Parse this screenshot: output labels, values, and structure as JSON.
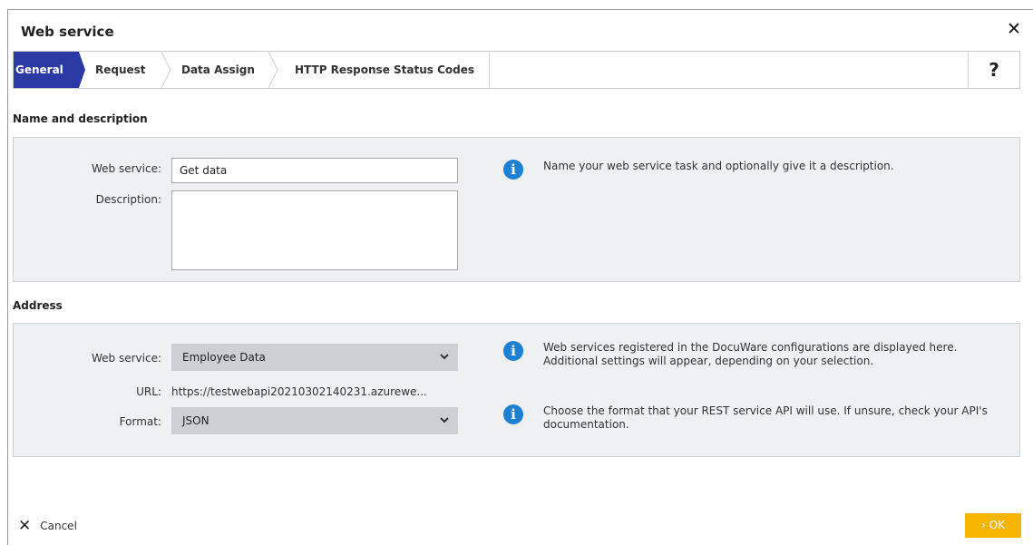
{
  "dialog": {
    "title": "Web service",
    "close_glyph": "✕"
  },
  "tabs": [
    {
      "label": "General",
      "active": true
    },
    {
      "label": "Request",
      "active": false
    },
    {
      "label": "Data Assign",
      "active": false
    },
    {
      "label": "HTTP Response Status Codes",
      "active": false
    }
  ],
  "help_glyph": "?",
  "name_section": {
    "heading": "Name and description",
    "web_service_label": "Web service:",
    "web_service_value": "Get data",
    "description_label": "Description:",
    "description_value": "",
    "info": "Name your web service task and optionally give it a description."
  },
  "address_section": {
    "heading": "Address",
    "web_service_label": "Web service:",
    "web_service_selected": "Employee Data",
    "url_label": "URL:",
    "url_value": "https://testwebapi20210302140231.azurewe...",
    "format_label": "Format:",
    "format_selected": "JSON",
    "info_1": "Web services registered in the DocuWare configurations are displayed here. Additional settings will appear, depending on your selection.",
    "info_2": "Choose the format that your REST service API will use. If unsure, check your API's documentation."
  },
  "footer": {
    "cancel_glyph": "✕",
    "cancel_label": "Cancel",
    "ok_label": "› OK"
  },
  "colors": {
    "active_tab": "#2b3aa3",
    "info_icon": "#1f7fd0",
    "ok_button": "#f7b500",
    "panel_bg": "#eef0f2"
  }
}
